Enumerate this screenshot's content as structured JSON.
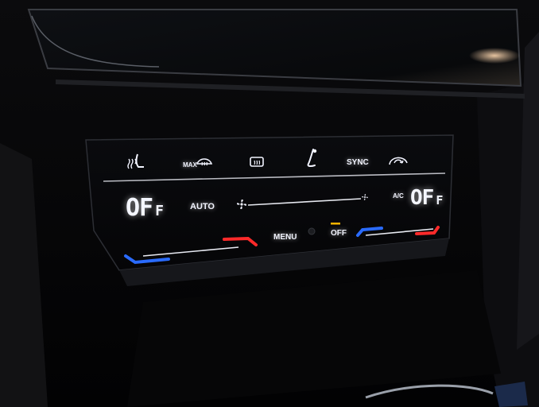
{
  "top_row": {
    "seat_heat_icon": "seat-heat-icon",
    "max_defrost_label": "MAX",
    "max_defrost_icon": "windshield-defrost-icon",
    "rear_defrost_icon": "rear-window-defrost-icon",
    "seat_vent_icon": "seat-ventilation-icon",
    "sync_label": "SYNC",
    "recirculation_icon": "air-recirculation-icon"
  },
  "left_zone": {
    "temperature": "OF",
    "unit": "F",
    "auto_label": "AUTO",
    "slider_colors": {
      "cold": "#2a6bff",
      "hot": "#ff2a2a"
    }
  },
  "fan": {
    "icon": "fan-icon"
  },
  "right_zone": {
    "ac_label": "A/C",
    "temperature": "OF",
    "unit": "F"
  },
  "bottom_row": {
    "menu_label": "MENU",
    "off_label": "OFF",
    "off_indicator_color": "#ffb400"
  }
}
